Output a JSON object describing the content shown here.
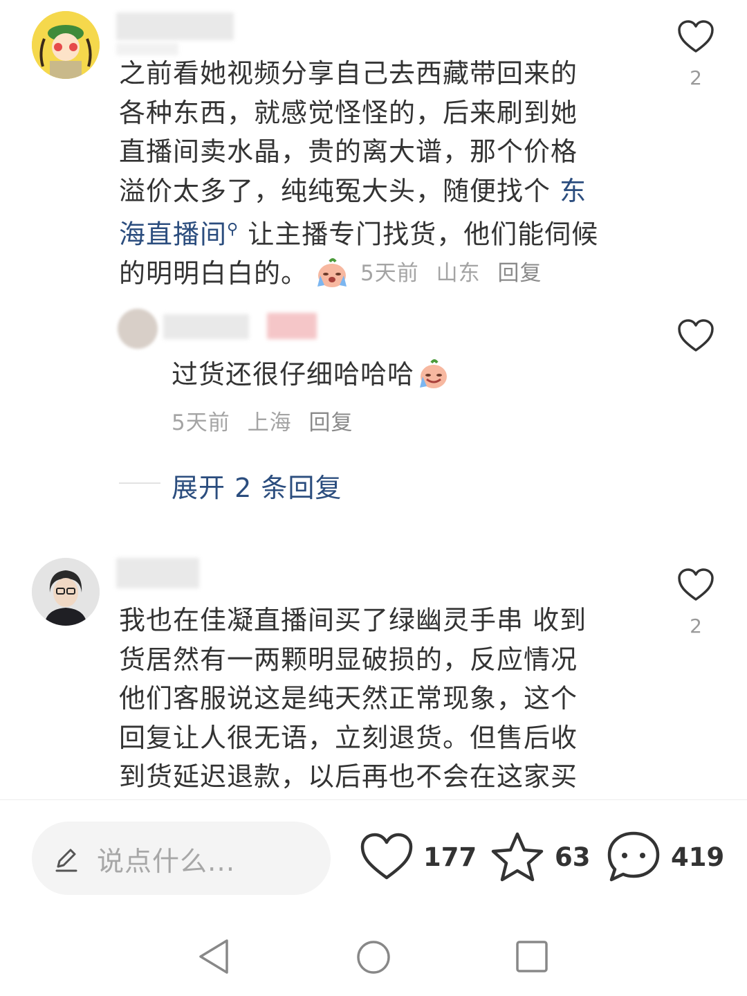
{
  "comments": [
    {
      "text_before_link": "之前看她视频分享自己去西藏带回来的各种东西，就感觉怪怪的，后来刷到她直播间卖水晶，贵的离大谱，那个价格溢价太多了，纯纯冤大头，随便找个",
      "link_text": "东海直播间",
      "text_after_link": "让主播专门找货，他们能伺候的明明白白的。",
      "emoji": "crying-peach-emoji",
      "time": "5天前",
      "location": "山东",
      "reply_label": "回复",
      "like_count": "2",
      "lines": [
        "之前看她视频分享自己去西藏带回来的",
        "各种东西，就感觉怪怪的，后来刷到她",
        "直播间卖水晶，贵的离大谱，那个价格",
        "溢价太多了，纯纯冤大头，随便找个 ",
        "东",
        "海直播间",
        " 让主播专门找货，他们能伺候",
        "的明明白白的。"
      ],
      "reply": {
        "text": "过货还很仔细哈哈哈",
        "time": "5天前",
        "location": "上海",
        "reply_label": "回复"
      },
      "expand_label": "展开 2 条回复"
    },
    {
      "like_count": "2",
      "lines": [
        "我也在佳凝直播间买了绿幽灵手串 收到",
        "货居然有一两颗明显破损的，反应情况",
        "他们客服说这是纯天然正常现象，这个",
        "回复让人很无语，立刻退货。但售后收",
        "到货延迟退款，以后再也不会在这家买"
      ]
    }
  ],
  "bottom_bar": {
    "input_placeholder": "说点什么...",
    "likes": "177",
    "favorites": "63",
    "comments": "419"
  },
  "colors": {
    "link": "#2b4d7e",
    "meta": "#a4a4a4",
    "text": "#333333"
  }
}
